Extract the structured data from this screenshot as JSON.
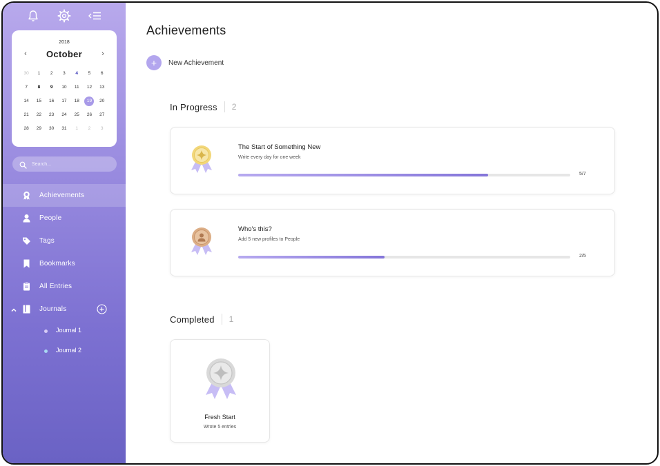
{
  "sidebar": {
    "calendar": {
      "year": "2018",
      "month": "October",
      "prev_icon": "‹",
      "next_icon": "›",
      "weeks": [
        [
          {
            "d": "30",
            "s": "muted"
          },
          {
            "d": "1"
          },
          {
            "d": "2"
          },
          {
            "d": "3"
          },
          {
            "d": "4",
            "s": "today-blue"
          },
          {
            "d": "5"
          },
          {
            "d": "6"
          }
        ],
        [
          {
            "d": "7"
          },
          {
            "d": "8",
            "s": "bold"
          },
          {
            "d": "9",
            "s": "bold"
          },
          {
            "d": "10"
          },
          {
            "d": "11"
          },
          {
            "d": "12"
          },
          {
            "d": "13"
          }
        ],
        [
          {
            "d": "14"
          },
          {
            "d": "15"
          },
          {
            "d": "16"
          },
          {
            "d": "17"
          },
          {
            "d": "18"
          },
          {
            "d": "19",
            "s": "selected"
          },
          {
            "d": "20"
          }
        ],
        [
          {
            "d": "21"
          },
          {
            "d": "22"
          },
          {
            "d": "23"
          },
          {
            "d": "24"
          },
          {
            "d": "25"
          },
          {
            "d": "26"
          },
          {
            "d": "27"
          }
        ],
        [
          {
            "d": "28"
          },
          {
            "d": "29"
          },
          {
            "d": "30"
          },
          {
            "d": "31"
          },
          {
            "d": "1",
            "s": "muted"
          },
          {
            "d": "2",
            "s": "muted"
          },
          {
            "d": "3",
            "s": "muted"
          }
        ]
      ]
    },
    "search": {
      "placeholder": "Search..."
    },
    "nav": {
      "achievements": "Achievements",
      "people": "People",
      "tags": "Tags",
      "bookmarks": "Bookmarks",
      "all_entries": "All Entries",
      "journals": "Journals"
    },
    "journals": [
      {
        "label": "Journal 1",
        "dot_color": "#d7ccf6"
      },
      {
        "label": "Journal 2",
        "dot_color": "#a8d8f2"
      }
    ]
  },
  "main": {
    "title": "Achievements",
    "new_button": "New Achievement",
    "in_progress": {
      "label": "In Progress",
      "count": "2",
      "items": [
        {
          "title": "The Start of Something New",
          "description": "Write every day for one week",
          "progress": "5/7",
          "fraction": 0.752,
          "medal": "gold-medal-icon"
        },
        {
          "title": "Who's this?",
          "description": "Add 5 new profiles to People",
          "progress": "2/5",
          "fraction": 0.44,
          "medal": "bronze-medal-icon"
        }
      ]
    },
    "completed": {
      "label": "Completed",
      "count": "1",
      "items": [
        {
          "title": "Fresh Start",
          "description": "Wrote 5 entries",
          "medal": "silver-medal-icon"
        }
      ]
    }
  },
  "colors": {
    "accent": "#a89ae8",
    "sidebar_top": "#b8a9ec",
    "sidebar_bottom": "#6a62c4",
    "progress_fill": "#8475d9",
    "medal_gold": "#f2d77a",
    "medal_bronze": "#dcae86",
    "medal_silver": "#d9d9d9",
    "ribbon": "#c7bdf5"
  }
}
